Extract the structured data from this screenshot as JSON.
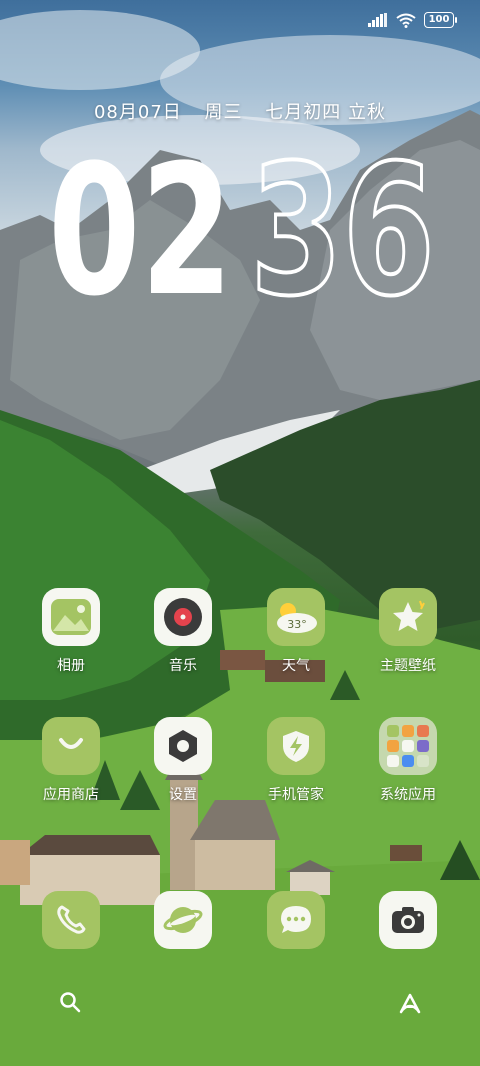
{
  "status_bar": {
    "signal_icon": "cellular-signal-icon",
    "wifi_icon": "wifi-icon",
    "battery": "100"
  },
  "lock_info": {
    "date": "08月07日",
    "weekday": "周三",
    "lunar": "七月初四 立秋"
  },
  "clock": {
    "hours": "02",
    "minutes": "36"
  },
  "apps_row1": [
    {
      "label": "相册",
      "icon": "gallery-icon"
    },
    {
      "label": "音乐",
      "icon": "music-icon"
    },
    {
      "label": "天气",
      "icon": "weather-icon",
      "badge": "33°"
    },
    {
      "label": "主题壁纸",
      "icon": "themes-icon"
    }
  ],
  "apps_row2": [
    {
      "label": "应用商店",
      "icon": "app-store-icon"
    },
    {
      "label": "设置",
      "icon": "settings-icon"
    },
    {
      "label": "手机管家",
      "icon": "security-icon"
    },
    {
      "label": "系统应用",
      "icon": "system-apps-folder-icon"
    }
  ],
  "dock": [
    {
      "icon": "phone-icon"
    },
    {
      "icon": "browser-icon"
    },
    {
      "icon": "messages-icon"
    },
    {
      "icon": "camera-icon"
    }
  ],
  "bottom": {
    "search_icon": "search-icon",
    "assistant_icon": "assistant-icon"
  },
  "colors": {
    "icon_olive": "#a4c463",
    "icon_white": "#f6f7f1"
  }
}
